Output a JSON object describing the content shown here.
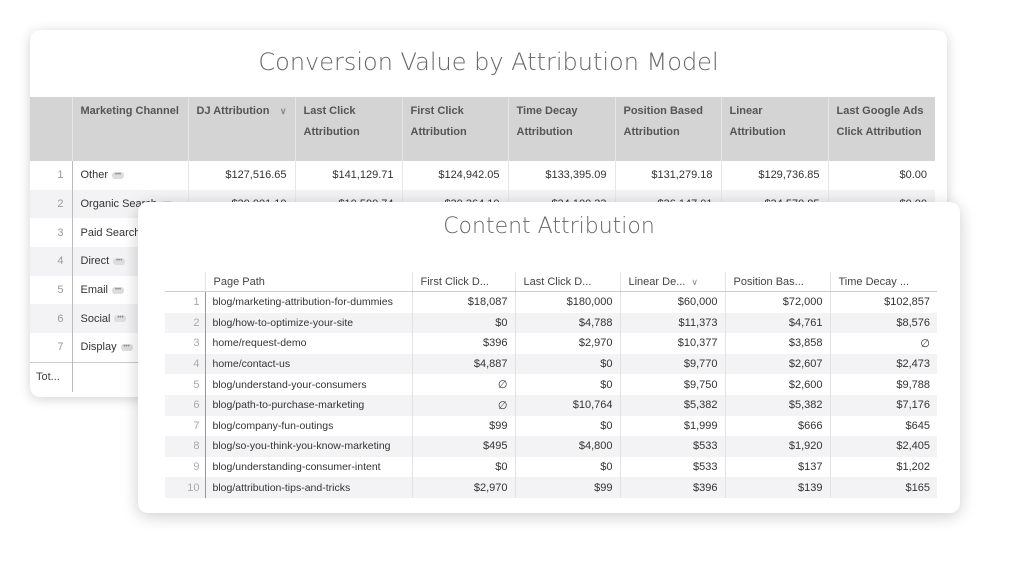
{
  "back": {
    "title": "Conversion Value by Attribution Model",
    "columns": [
      "Marketing Channel",
      "DJ Attribution",
      "Last Click Attribution",
      "First Click Attribution",
      "Time Decay Attribution",
      "Position Based Attribution",
      "Linear Attribution",
      "Last Google Ads Click Attribution"
    ],
    "sorted_column": "DJ Attribution",
    "rows": [
      {
        "idx": "1",
        "channel": "Other",
        "values": [
          "$127,516.65",
          "$141,129.71",
          "$124,942.05",
          "$133,395.09",
          "$131,279.18",
          "$129,736.85",
          "$0.00"
        ]
      },
      {
        "idx": "2",
        "channel": "Organic Search",
        "values": [
          "$30,001.10",
          "$10,590.74",
          "$30,364.10",
          "$34,100.33",
          "$36,147.01",
          "$34,570.85",
          "$0.00"
        ]
      },
      {
        "idx": "3",
        "channel": "Paid Search",
        "values": [
          "",
          "",
          "",
          "",
          "",
          "",
          ""
        ]
      },
      {
        "idx": "4",
        "channel": "Direct",
        "values": [
          "",
          "",
          "",
          "",
          "",
          "",
          ""
        ]
      },
      {
        "idx": "5",
        "channel": "Email",
        "values": [
          "",
          "",
          "",
          "",
          "",
          "",
          ""
        ]
      },
      {
        "idx": "6",
        "channel": "Social",
        "values": [
          "",
          "",
          "",
          "",
          "",
          "",
          ""
        ]
      },
      {
        "idx": "7",
        "channel": "Display",
        "values": [
          "",
          "",
          "",
          "",
          "",
          "",
          ""
        ]
      }
    ],
    "total_label": "Tot...",
    "more_icon": "ellipsis-icon"
  },
  "front": {
    "title": "Content Attribution",
    "columns": [
      "Page Path",
      "First Click D...",
      "Last Click D...",
      "Linear De...",
      "Position Bas...",
      "Time Decay ..."
    ],
    "sorted_column": "Linear De...",
    "null_symbol": "∅",
    "rows": [
      {
        "idx": "1",
        "path": "blog/marketing-attribution-for-dummies",
        "values": [
          "$18,087",
          "$180,000",
          "$60,000",
          "$72,000",
          "$102,857"
        ]
      },
      {
        "idx": "2",
        "path": "blog/how-to-optimize-your-site",
        "values": [
          "$0",
          "$4,788",
          "$11,373",
          "$4,761",
          "$8,576"
        ]
      },
      {
        "idx": "3",
        "path": "home/request-demo",
        "values": [
          "$396",
          "$2,970",
          "$10,377",
          "$3,858",
          "∅"
        ]
      },
      {
        "idx": "4",
        "path": "home/contact-us",
        "values": [
          "$4,887",
          "$0",
          "$9,770",
          "$2,607",
          "$2,473"
        ]
      },
      {
        "idx": "5",
        "path": "blog/understand-your-consumers",
        "values": [
          "∅",
          "$0",
          "$9,750",
          "$2,600",
          "$9,788"
        ]
      },
      {
        "idx": "6",
        "path": "blog/path-to-purchase-marketing",
        "values": [
          "∅",
          "$10,764",
          "$5,382",
          "$5,382",
          "$7,176"
        ]
      },
      {
        "idx": "7",
        "path": "blog/company-fun-outings",
        "values": [
          "$99",
          "$0",
          "$1,999",
          "$666",
          "$645"
        ]
      },
      {
        "idx": "8",
        "path": "blog/so-you-think-you-know-marketing",
        "values": [
          "$495",
          "$4,800",
          "$533",
          "$1,920",
          "$2,405"
        ]
      },
      {
        "idx": "9",
        "path": "blog/understanding-consumer-intent",
        "values": [
          "$0",
          "$0",
          "$533",
          "$137",
          "$1,202"
        ]
      },
      {
        "idx": "10",
        "path": "blog/attribution-tips-and-tricks",
        "values": [
          "$2,970",
          "$99",
          "$396",
          "$139",
          "$165"
        ]
      }
    ]
  }
}
